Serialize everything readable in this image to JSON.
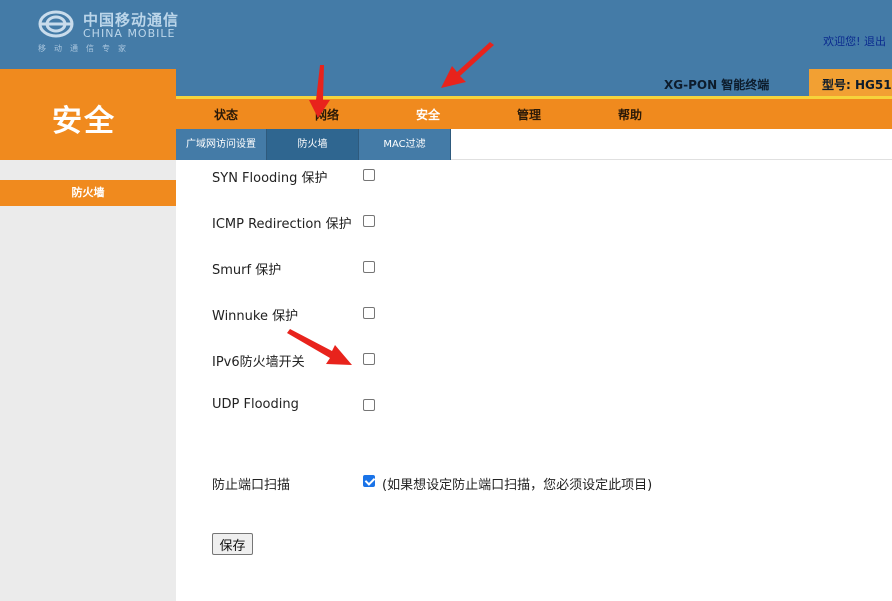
{
  "brand": {
    "cn": "中国移动通信",
    "en": "CHINA MOBILE",
    "slogan": "移动通信专家"
  },
  "header": {
    "welcome": "欢迎您!",
    "logout": "退出"
  },
  "section": {
    "title": "安全"
  },
  "product": {
    "name": "XG-PON 智能终端",
    "model": "型号: HG51"
  },
  "nav": [
    {
      "label": "状态"
    },
    {
      "label": "网络"
    },
    {
      "label": "安全"
    },
    {
      "label": "管理"
    },
    {
      "label": "帮助"
    }
  ],
  "subtabs": [
    {
      "label": "广域网访问设置"
    },
    {
      "label": "防火墙"
    },
    {
      "label": "MAC过滤"
    }
  ],
  "sidebar": {
    "items": [
      {
        "label": "防火墙"
      }
    ]
  },
  "form": {
    "rows": [
      {
        "label": "SYN Flooding 保护",
        "checked": false
      },
      {
        "label": "ICMP Redirection 保护",
        "checked": false
      },
      {
        "label": "Smurf 保护",
        "checked": false
      },
      {
        "label": "Winnuke 保护",
        "checked": false
      },
      {
        "label": "IPv6防火墙开关",
        "checked": false
      },
      {
        "label": "UDP Flooding",
        "checked": false
      }
    ],
    "port_scan": {
      "label": "防止端口扫描",
      "checked": true,
      "note": "(如果想设定防止端口扫描，您必须设定此项目)"
    },
    "save_label": "保存"
  },
  "colors": {
    "header_blue": "#447ba7",
    "orange": "#f08a1e",
    "yellow_line": "#f6d33b",
    "annotation_red": "#e8231c"
  }
}
